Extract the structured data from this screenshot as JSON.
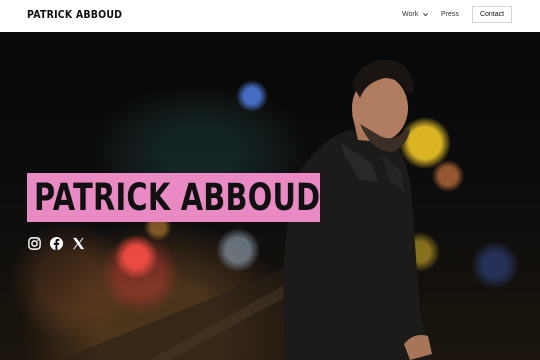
{
  "header": {
    "logo": "PATRICK ABBOUD",
    "nav": {
      "work_label": "Work",
      "press_label": "Press",
      "contact_label": "Contact"
    }
  },
  "hero": {
    "title": "PATRICK ABBOUD",
    "highlight_color": "#e98ac4",
    "social_icons": [
      "instagram-icon",
      "facebook-icon",
      "x-icon"
    ]
  }
}
